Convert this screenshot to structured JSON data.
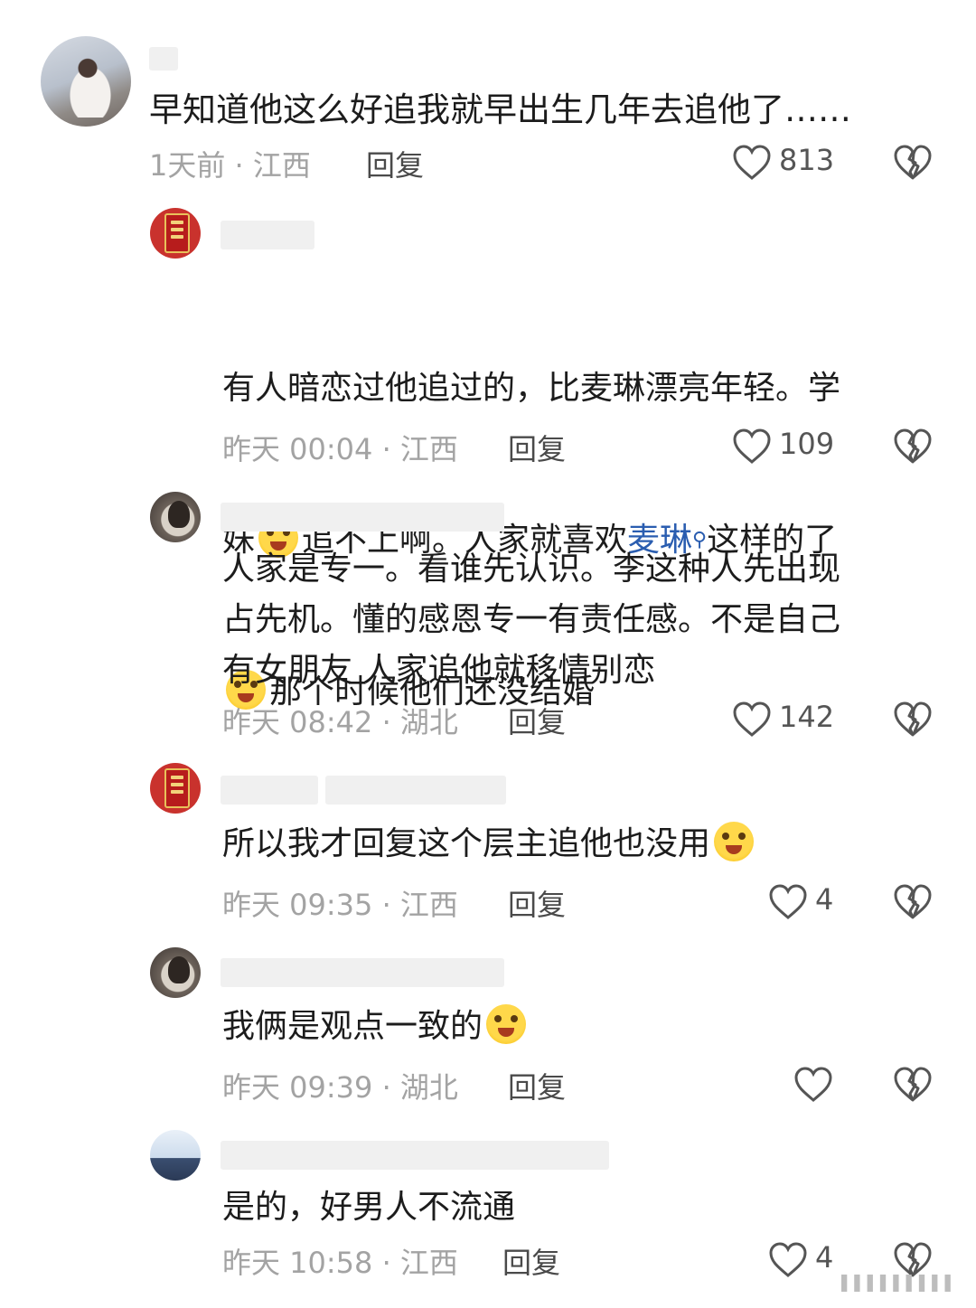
{
  "comments": [
    {
      "text": "早知道他这么好追我就早出生几年去追他了……",
      "time_location": "1天前 · 江西",
      "reply_label": "回复",
      "likes": "813"
    },
    {
      "text_part1": "有人暗恋过他追过的，比麦琳漂亮年轻。学",
      "text_part2a": "妹",
      "text_part2b": "追不上啊。人家就喜欢",
      "text_link": "麦琳",
      "text_part2c": "这样的了",
      "text_part3": "那个时候他们还没结婚",
      "time_location": "昨天 00:04 · 江西",
      "reply_label": "回复",
      "likes": "109"
    },
    {
      "text": "人家是专一。看谁先认识。李这种人先出现\n占先机。懂的感恩专一有责任感。不是自己\n有女朋友 人家追他就移情别恋",
      "time_location": "昨天 08:42 · 湖北",
      "reply_label": "回复",
      "likes": "142"
    },
    {
      "text": "所以我才回复这个层主追他也没用",
      "time_location": "昨天 09:35 · 江西",
      "reply_label": "回复",
      "likes": "4"
    },
    {
      "text": "我俩是观点一致的",
      "time_location": "昨天 09:39 · 湖北",
      "reply_label": "回复",
      "likes": ""
    },
    {
      "text": "是的，好男人不流通",
      "time_location": "昨天 10:58 · 江西",
      "reply_label": "回复",
      "likes": "4"
    }
  ],
  "icons": {
    "like": "heart-outline-icon",
    "dislike": "broken-heart-icon",
    "emoji": "laughing-crying-emoji",
    "search": "search-icon"
  },
  "colors": {
    "text": "#1c1c1c",
    "meta": "#a3a3a3",
    "link": "#2a5db0"
  }
}
